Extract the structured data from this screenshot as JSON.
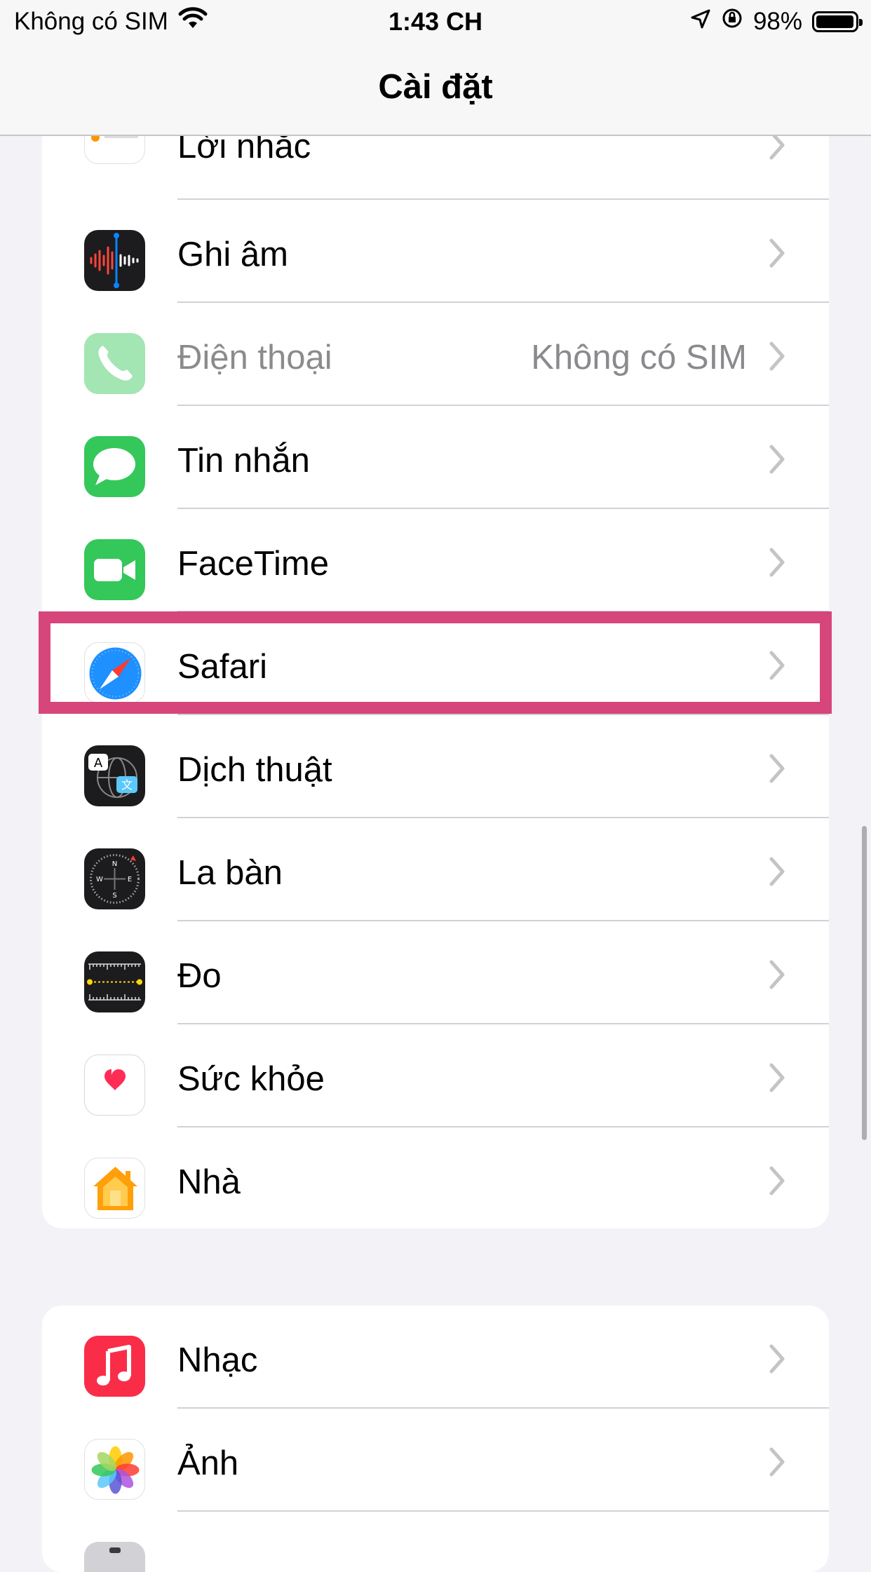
{
  "status_bar": {
    "carrier": "Không có SIM",
    "time": "1:43 CH",
    "battery": "98%",
    "battery_level": 0.98,
    "icons": [
      "wifi-icon",
      "location-arrow-icon",
      "orientation-lock-icon",
      "battery-icon"
    ]
  },
  "nav": {
    "title": "Cài đặt"
  },
  "group1": {
    "items": [
      {
        "label": "Lời nhắc",
        "icon": "reminders-icon"
      },
      {
        "label": "Ghi âm",
        "icon": "voice-memos-icon"
      },
      {
        "label": "Điện thoại",
        "value": "Không có SIM",
        "icon": "phone-icon",
        "disabled": true
      },
      {
        "label": "Tin nhắn",
        "icon": "messages-icon"
      },
      {
        "label": "FaceTime",
        "icon": "facetime-icon"
      },
      {
        "label": "Safari",
        "icon": "safari-icon",
        "highlighted": true
      },
      {
        "label": "Dịch thuật",
        "icon": "translate-icon"
      },
      {
        "label": "La bàn",
        "icon": "compass-icon"
      },
      {
        "label": "Đo",
        "icon": "measure-icon"
      },
      {
        "label": "Sức khỏe",
        "icon": "health-icon"
      },
      {
        "label": "Nhà",
        "icon": "home-icon"
      }
    ]
  },
  "group2": {
    "items": [
      {
        "label": "Nhạc",
        "icon": "music-icon"
      },
      {
        "label": "Ảnh",
        "icon": "photos-icon"
      },
      {
        "label": "",
        "icon": "camera-icon"
      }
    ]
  },
  "colors": {
    "highlight": "#d6467a",
    "background": "#f2f2f7",
    "separator": "#d1d1d6"
  }
}
